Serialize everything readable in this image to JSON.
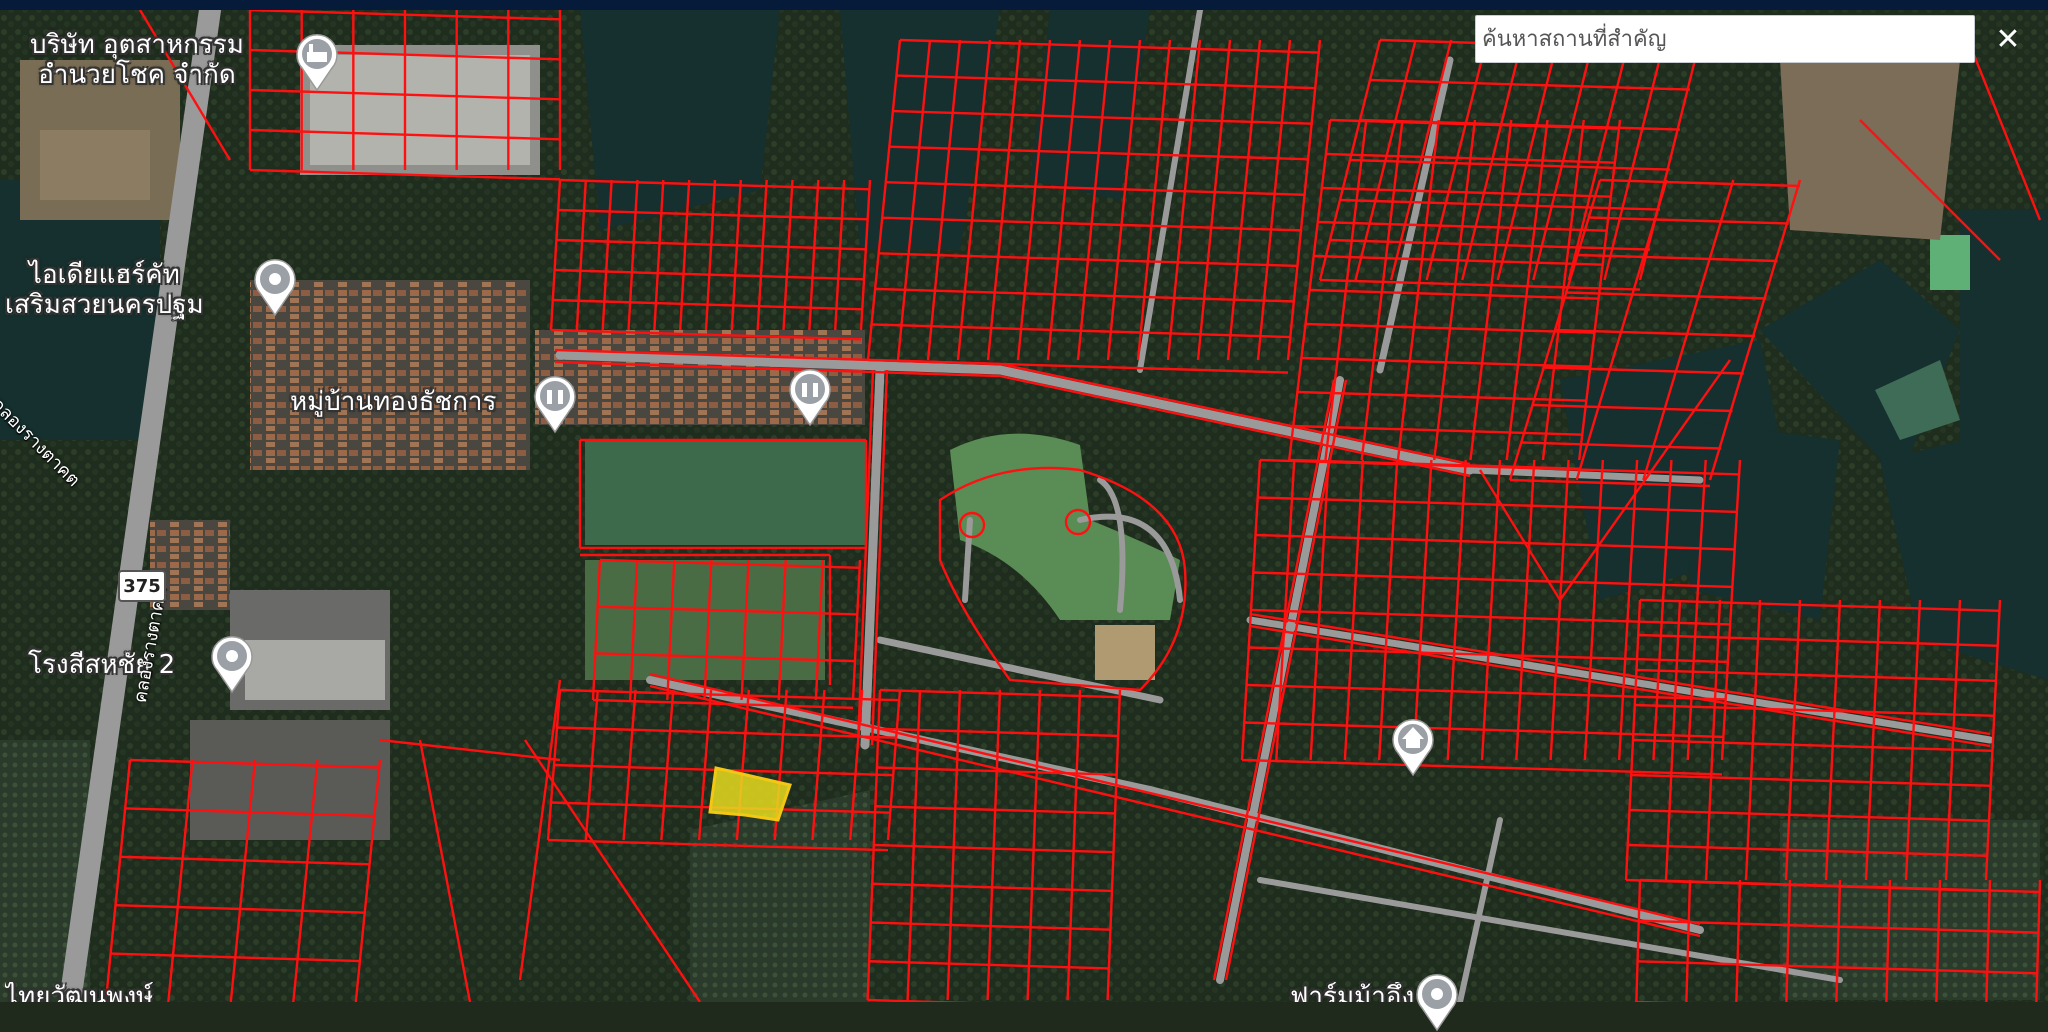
{
  "search": {
    "placeholder": "ค้นหาสถานที่สำคัญ"
  },
  "close_label": "✕",
  "road_number": "375",
  "places": [
    {
      "line1": "บริษัท อุตสาหกรรม",
      "line2": "อำนวยโชค จำกัด",
      "icon": "factory-icon"
    },
    {
      "line1": "ไอเดียแฮร์คัท",
      "line2": "เสริมสวยนครปฐม",
      "icon": "location-pin-icon"
    },
    {
      "line1": "หมู่บ้านทองธัชการ",
      "icon": "village-icon"
    },
    {
      "line1": "โรงสีสหชัย 2",
      "icon": "location-pin-icon"
    },
    {
      "line1": "ไทยวัฒนพงษ์",
      "icon": "partial-label"
    },
    {
      "line1": "ฟาร์มม้าอึ้ง",
      "icon": "location-pin-icon"
    }
  ],
  "canals": [
    {
      "name": "คลองรางตาคต"
    },
    {
      "name": "คลองรางตาคต"
    }
  ],
  "colors": {
    "parcel_line": "#ff1010",
    "selected_parcel": "#e6dc1e",
    "road": "#9a9a9a",
    "search_bar": "#061a3a"
  },
  "map_layers": [
    "satellite-imagery",
    "land-parcel-boundaries"
  ]
}
